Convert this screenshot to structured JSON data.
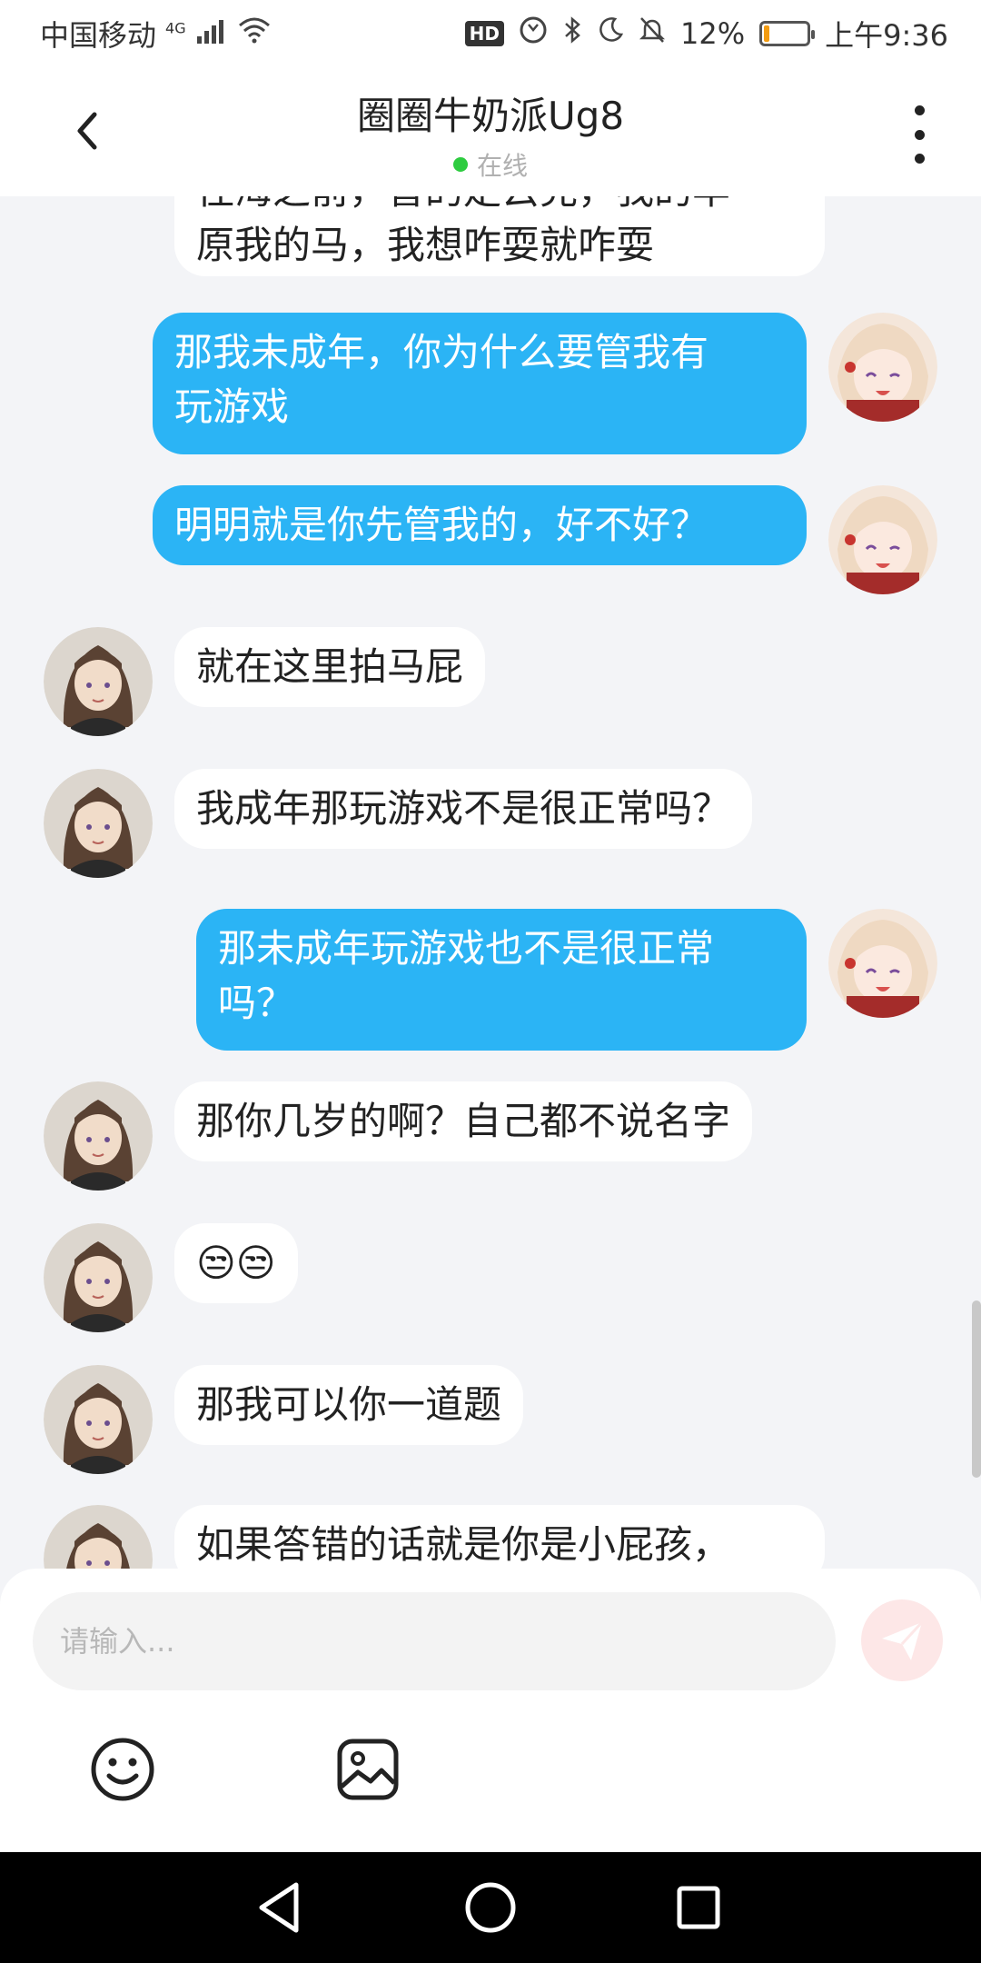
{
  "status_bar": {
    "carrier": "中国移动",
    "network": "4G",
    "hd_badge": "HD",
    "battery": "12%",
    "battery_level": 0.12,
    "time": "上午9:36"
  },
  "header": {
    "title": "圈圈牛奶派Ug8",
    "status": "在线"
  },
  "messages": [
    {
      "side": "in",
      "text": "原我的马，我想咋耍就咋耍",
      "partial_top": "往海之前，普的走云兜，我的羊"
    },
    {
      "side": "out",
      "lines": [
        "那我未成年，你为什么要管我有",
        "玩游戏"
      ]
    },
    {
      "side": "out",
      "text": "明明就是你先管我的，好不好？"
    },
    {
      "side": "in",
      "text": "就在这里拍马屁"
    },
    {
      "side": "in",
      "text": "我成年那玩游戏不是很正常吗？"
    },
    {
      "side": "out",
      "lines": [
        "那未成年玩游戏也不是很正常",
        "吗？"
      ]
    },
    {
      "side": "in",
      "text": "那你几岁的啊？自己都不说名字"
    },
    {
      "side": "in",
      "text": "😒😒"
    },
    {
      "side": "in",
      "text": "那我可以你一道题"
    },
    {
      "side": "in",
      "text": "如果答错的话就是你是小屁孩，"
    }
  ],
  "input": {
    "placeholder": "请输入..."
  },
  "icons": {
    "back": "back-arrow-icon",
    "more": "more-vertical-icon",
    "send": "send-icon",
    "emoji": "emoji-icon",
    "image": "image-icon"
  },
  "colors": {
    "outgoing_bubble": "#2BB4F5",
    "incoming_bubble": "#FFFFFF",
    "background": "#F3F4F7",
    "online_dot": "#2ECC40",
    "send_button": "#FDE7E7"
  }
}
